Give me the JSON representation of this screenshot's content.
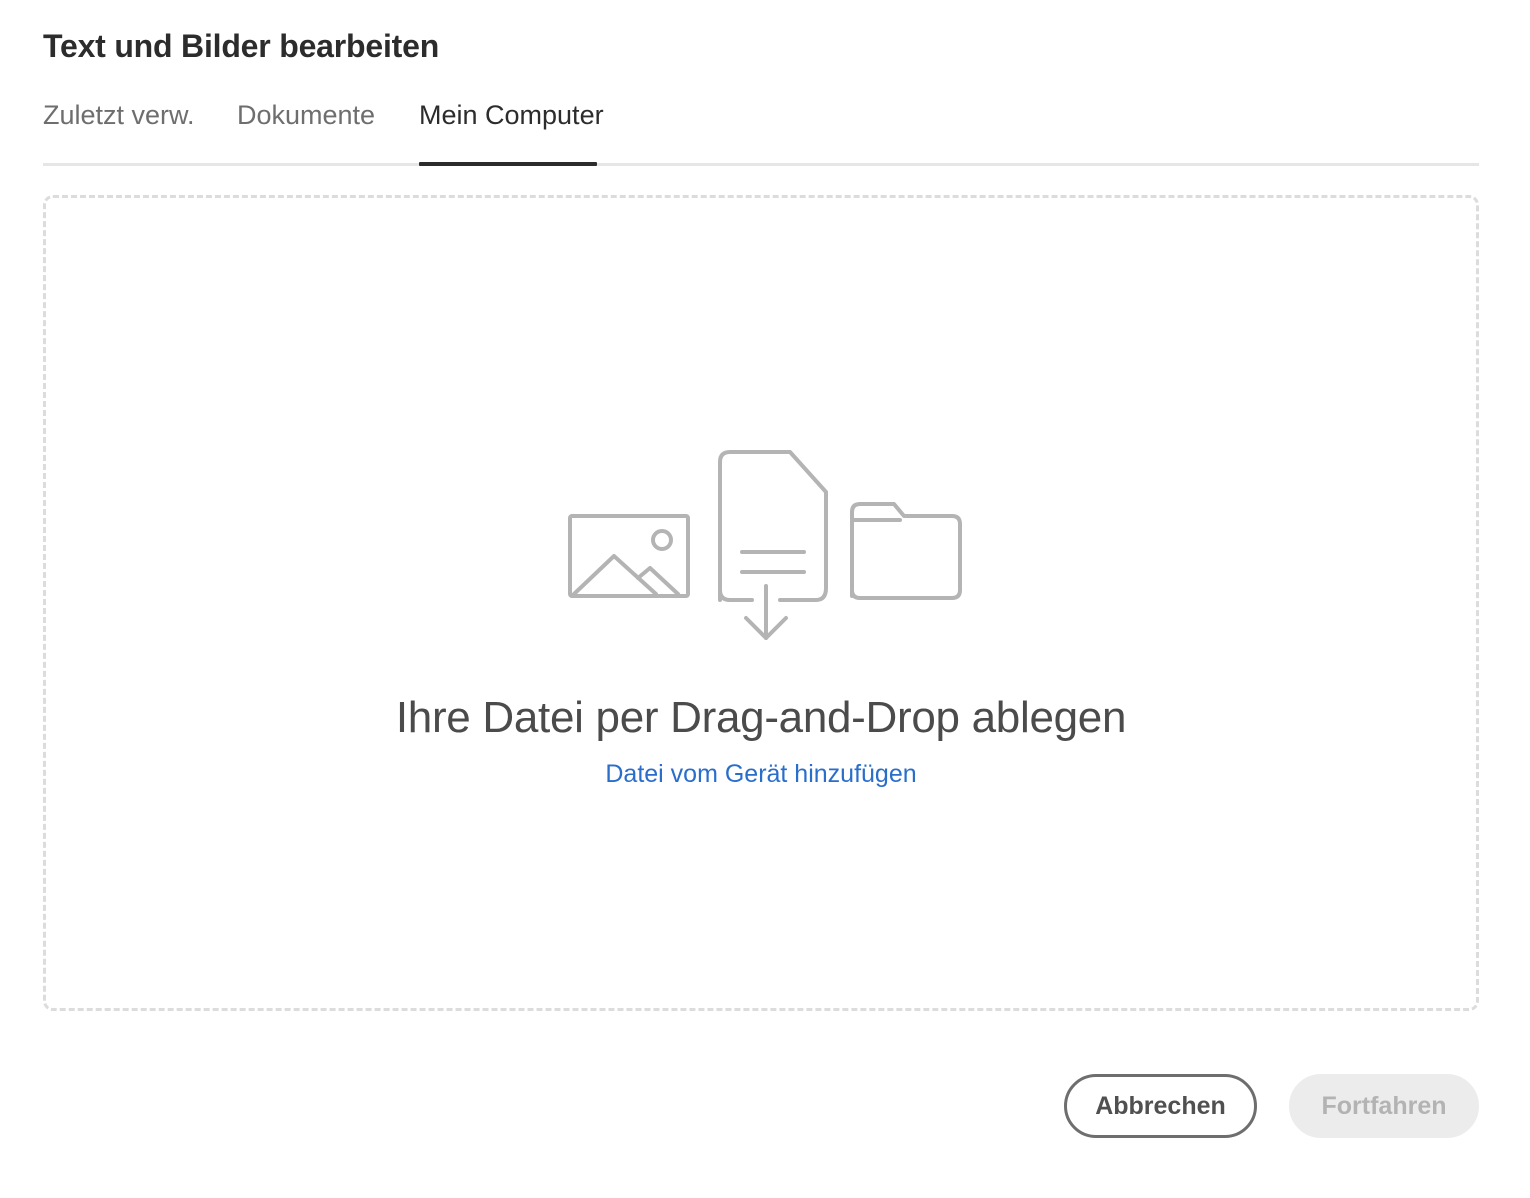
{
  "dialog": {
    "title": "Text und Bilder bearbeiten"
  },
  "tabs": [
    {
      "label": "Zuletzt verw.",
      "active": false
    },
    {
      "label": "Dokumente",
      "active": false
    },
    {
      "label": "Mein Computer",
      "active": true
    }
  ],
  "dropzone": {
    "icons": [
      "image-icon",
      "document-download-icon",
      "folder-icon"
    ],
    "title": "Ihre Datei per Drag-and-Drop ablegen",
    "link_label": "Datei vom Gerät hinzufügen"
  },
  "footer": {
    "cancel_label": "Abbrechen",
    "continue_label": "Fortfahren",
    "continue_enabled": false
  },
  "colors": {
    "link": "#2a6ecb",
    "icon_gray": "#b4b4b4",
    "active_tab_underline": "#2c2c2c",
    "disabled_button_bg": "#ececec"
  }
}
